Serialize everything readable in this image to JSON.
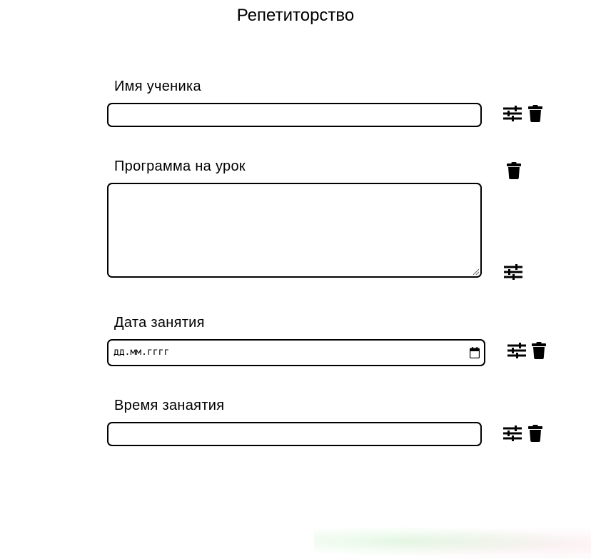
{
  "header": {
    "title": "Репетиторство"
  },
  "form": {
    "student_name": {
      "label": "Имя ученика",
      "value": "",
      "placeholder": ""
    },
    "lesson_program": {
      "label": "Программа на урок",
      "value": "",
      "placeholder": ""
    },
    "lesson_date": {
      "label": "Дата занятия",
      "placeholder": "дд.мм.гггг"
    },
    "lesson_time": {
      "label": "Время занаятия",
      "value": "",
      "placeholder": ""
    }
  },
  "icons": {
    "settings": "sliders-icon",
    "delete": "trash-icon",
    "calendar": "calendar-icon"
  }
}
